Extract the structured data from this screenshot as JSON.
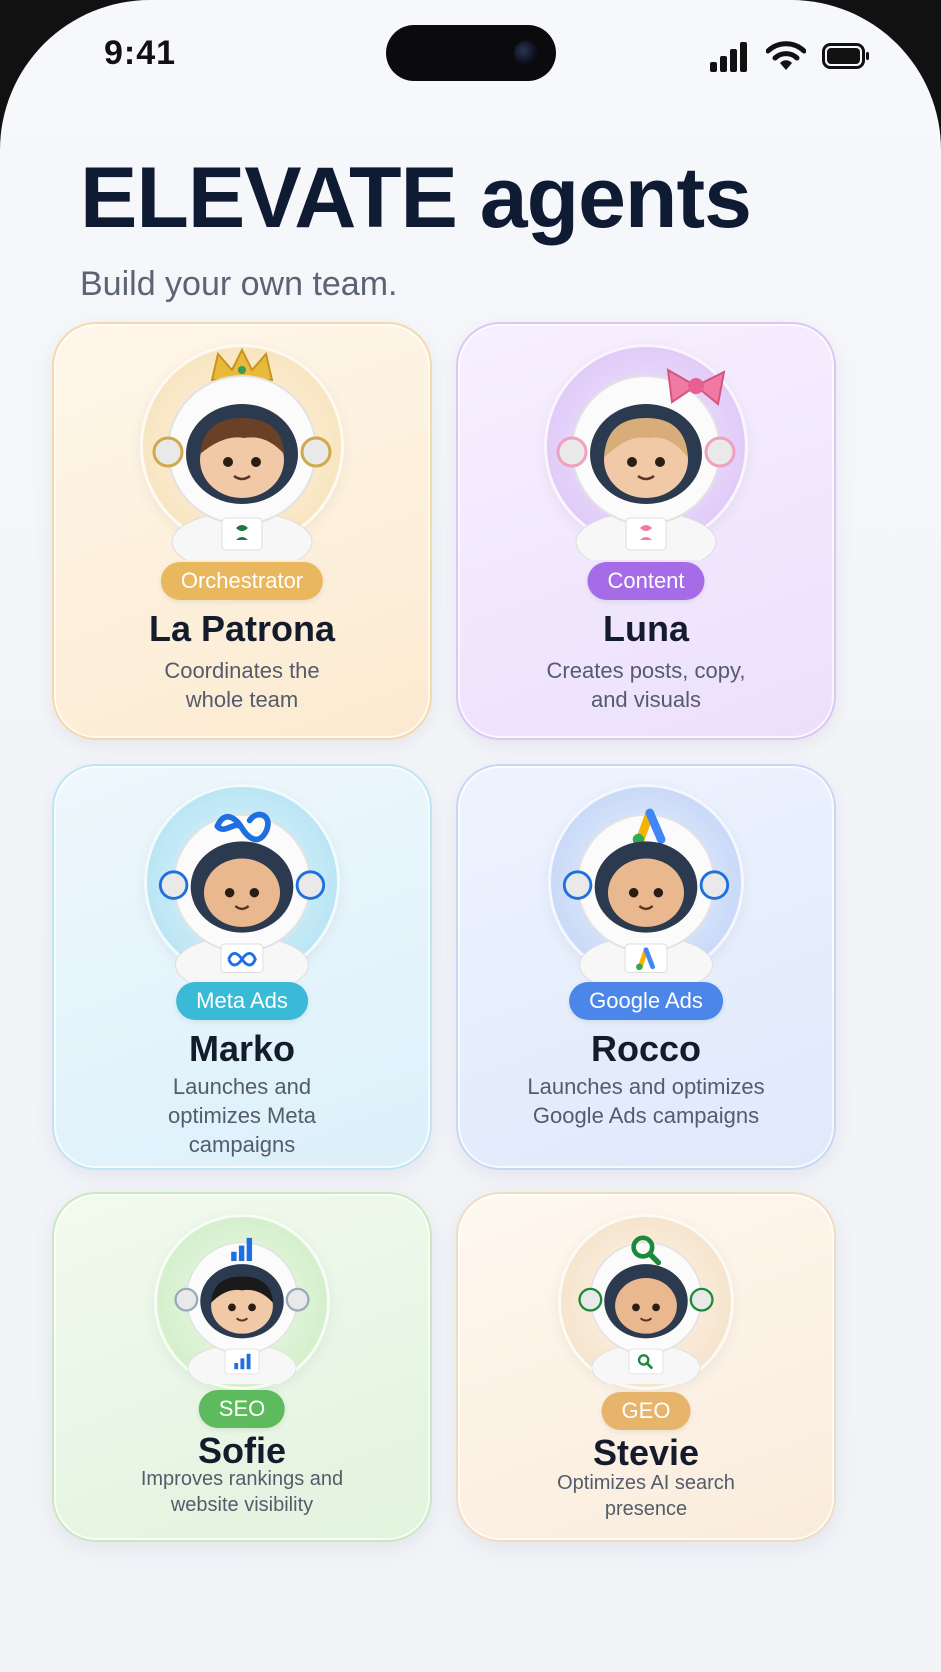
{
  "status_bar": {
    "time": "9:41"
  },
  "header": {
    "title": "ELEVATE agents",
    "subtitle": "Build your own team."
  },
  "agents": [
    {
      "role": "Orchestrator",
      "name": "La Patrona",
      "description": "Coordinates the whole team",
      "badge_color": "#e8b75e",
      "accessory": "crown-icon",
      "chest": "leaf-logo-icon",
      "hair": "brown"
    },
    {
      "role": "Content",
      "name": "Luna",
      "description": "Creates posts, copy, and visuals",
      "badge_color": "#a66ce8",
      "accessory": "bow-icon",
      "chest": "leaf-logo-icon",
      "hair": "blonde"
    },
    {
      "role": "Meta Ads",
      "name": "Marko",
      "description": "Launches and optimizes Meta campaigns",
      "badge_color": "#3bbad8",
      "accessory": "meta-logo-icon",
      "chest": "meta-logo-icon",
      "hair": "none"
    },
    {
      "role": "Google Ads",
      "name": "Rocco",
      "description": "Launches and optimizes Google Ads campaigns",
      "badge_color": "#4b86e8",
      "accessory": "google-ads-logo-icon",
      "chest": "google-ads-logo-icon",
      "hair": "none"
    },
    {
      "role": "SEO",
      "name": "Sofie",
      "description": "Improves rankings and website visibility",
      "badge_color": "#5dbb5d",
      "accessory": "bar-chart-icon",
      "chest": "bar-chart-icon",
      "hair": "black"
    },
    {
      "role": "GEO",
      "name": "Stevie",
      "description": "Optimizes AI search presence",
      "badge_color": "#e6b46a",
      "accessory": "magnifier-icon",
      "chest": "magnifier-icon",
      "hair": "none"
    }
  ]
}
